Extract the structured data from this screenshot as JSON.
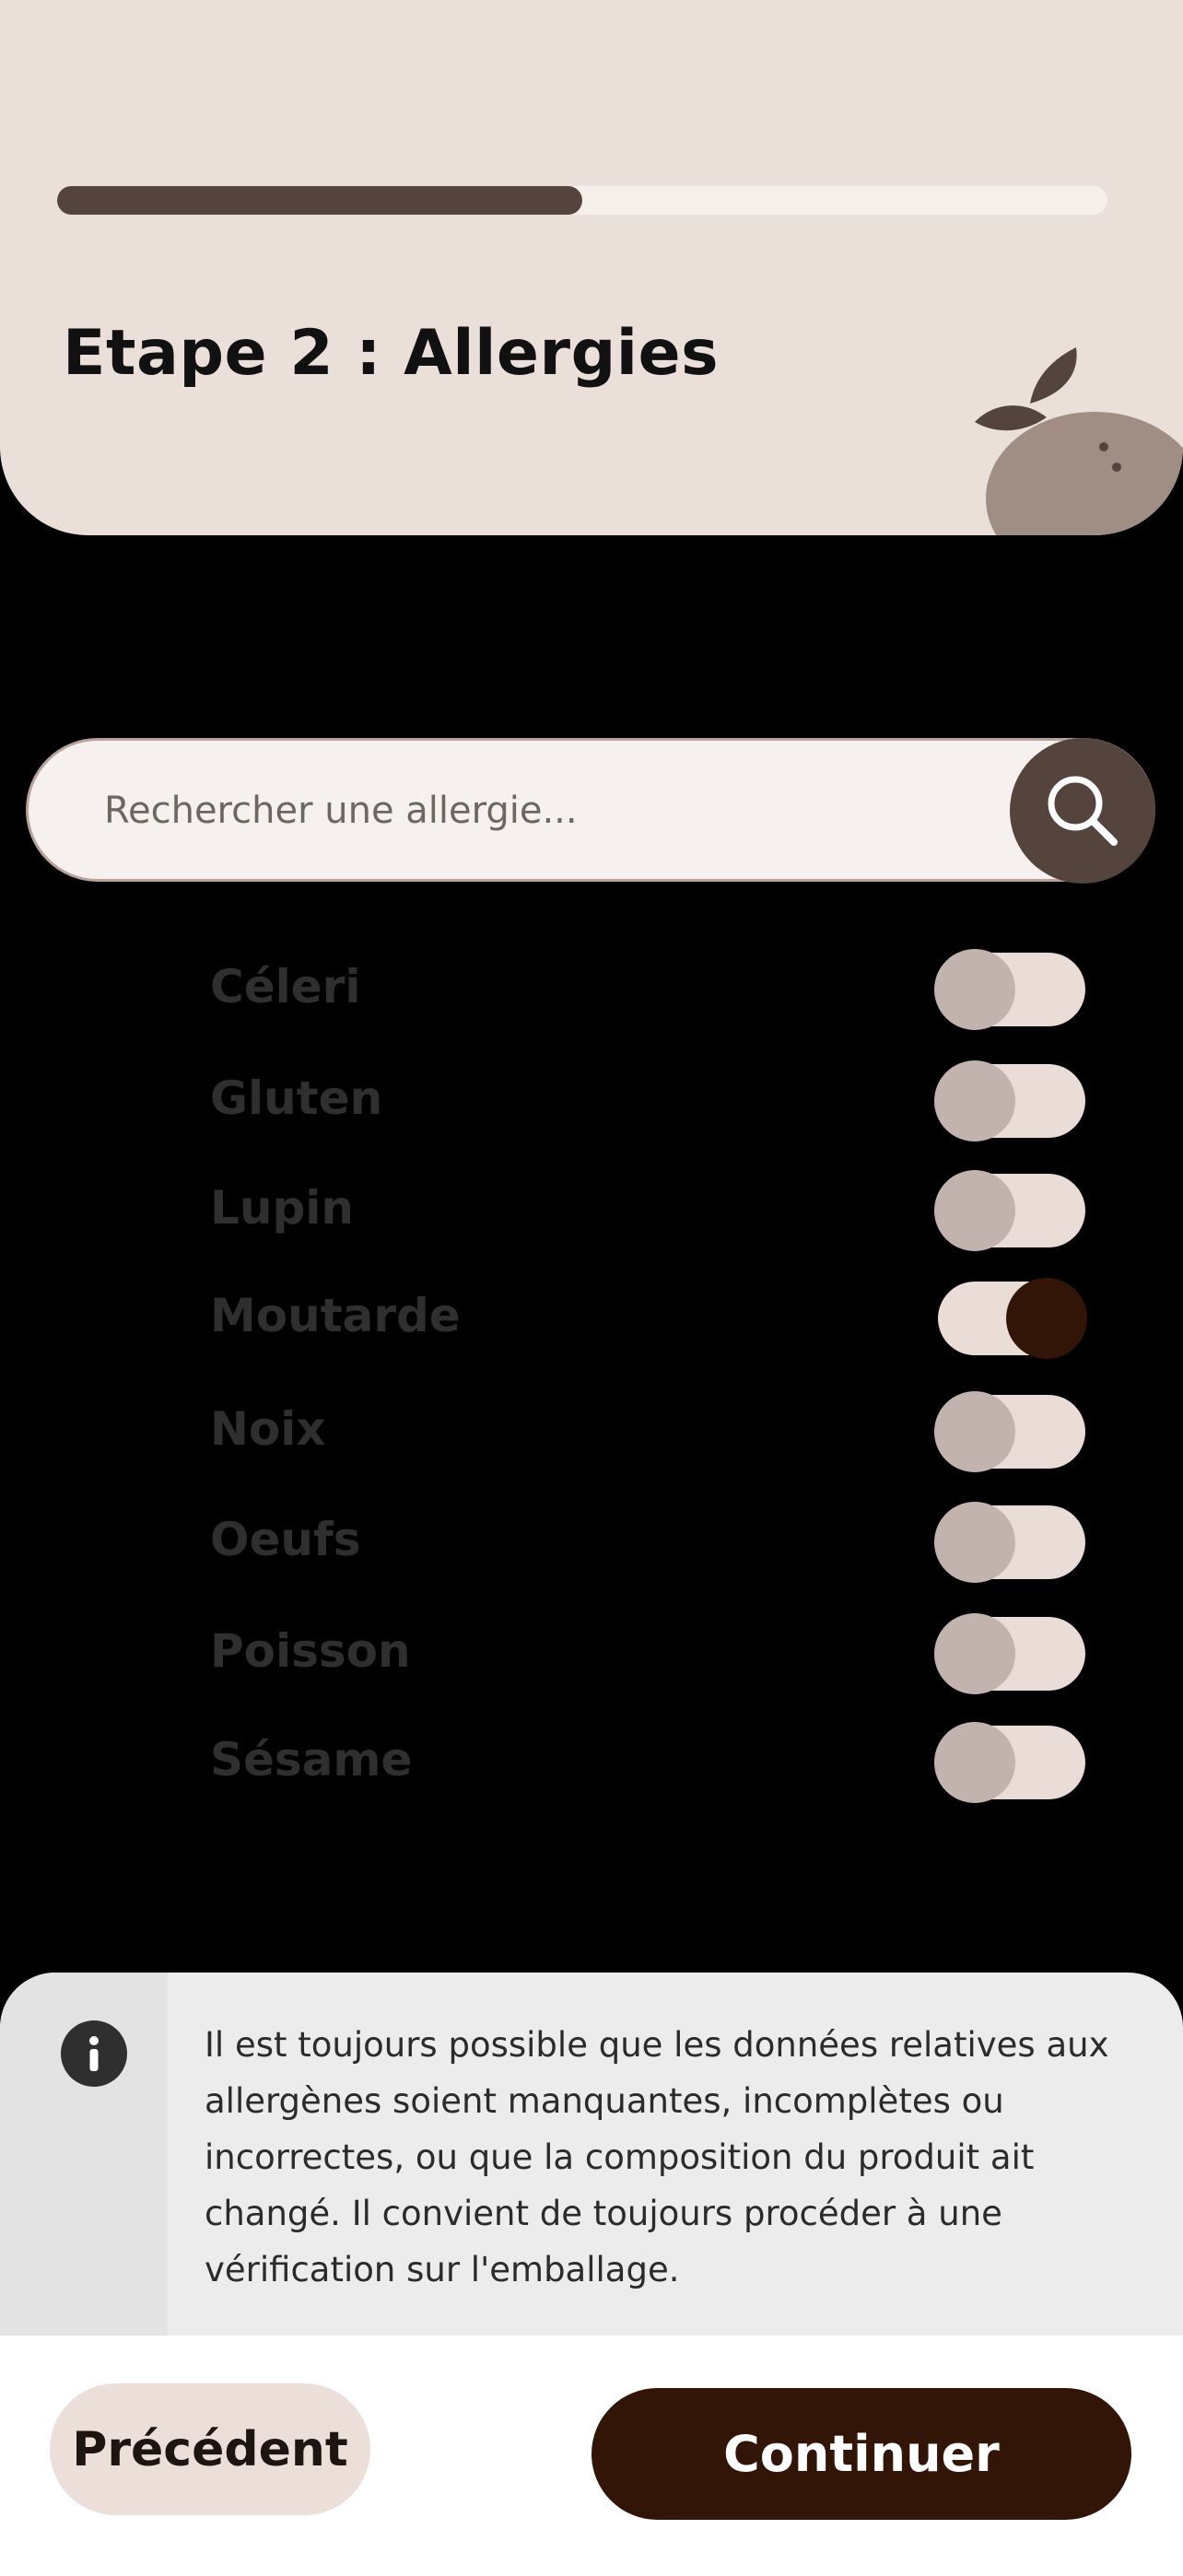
{
  "header": {
    "progress": 0.5,
    "title": "Etape 2 : Allergies"
  },
  "search": {
    "placeholder": "Rechercher une allergie...",
    "value": "",
    "icon": "search-icon"
  },
  "allergies": [
    {
      "label": "Céleri",
      "enabled": false
    },
    {
      "label": "Gluten",
      "enabled": false
    },
    {
      "label": "Lupin",
      "enabled": false
    },
    {
      "label": "Moutarde",
      "enabled": true
    },
    {
      "label": "Noix",
      "enabled": false
    },
    {
      "label": "Oeufs",
      "enabled": false
    },
    {
      "label": "Poisson",
      "enabled": false
    },
    {
      "label": "Sésame",
      "enabled": false
    }
  ],
  "disclaimer": {
    "icon": "info-icon",
    "text": "Il est toujours possible que les données relatives aux allergènes soient manquantes, incomplètes ou incorrectes, ou que la composition du produit ait changé. Il convient de toujours procéder à une vérification sur l'emballage."
  },
  "footer": {
    "previous_label": "Précédent",
    "continue_label": "Continuer"
  },
  "colors": {
    "header_bg": "#ebdfda",
    "progress_fill": "#54443d",
    "accent_dark": "#331507",
    "toggle_off_thumb": "#c3b3ae"
  }
}
